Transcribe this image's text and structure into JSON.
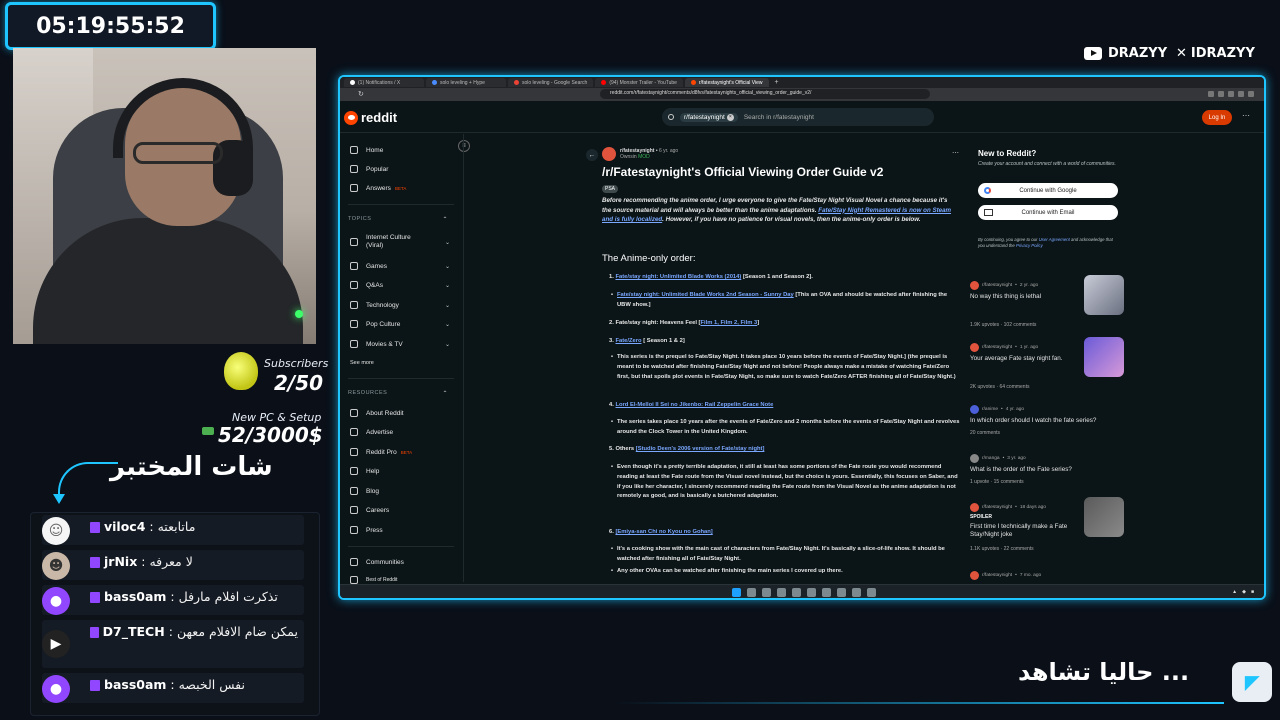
{
  "overlay": {
    "timer": "05:19:55:52",
    "subs_label": "Subscribers",
    "subs_count": "2/50",
    "pc_label": "New PC & Setup",
    "pc_count": "52/3000$",
    "chat_title": "شات المختبر",
    "youtube_handle": "DRAZYY",
    "x_handle": "IDRAZYY",
    "now_watching": "حاليا تشاهد ...",
    "chat": [
      {
        "user": "viloc4",
        "message": "ماتابعته"
      },
      {
        "user": "jrNix",
        "message": "لا معرفه"
      },
      {
        "user": "bass0am",
        "message": "تذكرت افلام مارفل"
      },
      {
        "user": "D7_TECH",
        "message": "يمكن ضام الافلام معهن"
      },
      {
        "user": "bass0am",
        "message": "نفس الخبصه"
      }
    ],
    "colors": {
      "accent": "#1ec5ff",
      "twitch": "#9146ff"
    }
  },
  "browser": {
    "tabs": [
      {
        "label": "(1) Notifications / X"
      },
      {
        "label": "solo leveling + Hype"
      },
      {
        "label": "solo leveling - Google Search"
      },
      {
        "label": "(94) Monster Trailer - YouTube"
      },
      {
        "label": "r/fatestaynight's Official View"
      }
    ],
    "url": "reddit.com/r/fatestaynight/comments/d8fvs/fatestaynights_official_viewing_order_guide_v2/"
  },
  "reddit": {
    "logo_text": "reddit",
    "search_chip": "r/fatestaynight",
    "search_placeholder": "Search in r/fatestaynight",
    "login_label": "Log In",
    "sidebar": {
      "main": [
        {
          "label": "Home"
        },
        {
          "label": "Popular"
        },
        {
          "label": "Answers",
          "badge": "BETA"
        }
      ],
      "topics_header": "TOPICS",
      "topics": [
        {
          "label": "Internet Culture (Viral)"
        },
        {
          "label": "Games"
        },
        {
          "label": "Q&As"
        },
        {
          "label": "Technology"
        },
        {
          "label": "Pop Culture"
        },
        {
          "label": "Movies & TV"
        }
      ],
      "see_more": "See more",
      "resources_header": "RESOURCES",
      "resources": [
        {
          "label": "About Reddit"
        },
        {
          "label": "Advertise"
        },
        {
          "label": "Reddit Pro",
          "badge": "BETA"
        },
        {
          "label": "Help"
        },
        {
          "label": "Blog"
        },
        {
          "label": "Careers"
        },
        {
          "label": "Press"
        }
      ],
      "communities": "Communities",
      "best_of": "Best of Reddit"
    },
    "post": {
      "subreddit": "r/fatestaynight",
      "age": "6 yr. ago",
      "author": "Ownsin",
      "author_flair": "MOD",
      "title": "/r/Fatestaynight's Official Viewing Order Guide v2",
      "flair": "PSA",
      "intro": "Before recommending the anime order, I urge everyone to give the Fate/Stay Night Visual Novel a chance because it's the source material and will always be better than the anime adaptations.",
      "intro_link": "Fate/Stay Night Remastered is now on Steam and is fully localized",
      "intro_tail": ". However, if you have no patience for visual novels, then the anime-only order is below.",
      "section_heading": "The Anime-only order:",
      "item1_num": "1.",
      "item1_link": "Fate/stay night: Unlimited Blade Works (2014)",
      "item1_tail": "[Season 1 and Season 2].",
      "item1_sub_link": "Fate/stay night: Unlimited Blade Works 2nd Season - Sunny Day",
      "item1_sub_tail": "[This an OVA and should be watched after finishing the UBW show.]",
      "item2_text": "2. Fate/stay night: Heavens Feel [",
      "item2_link": "Film 1, Film 2, Film 3",
      "item2_tail": "]",
      "item3_num": "3.",
      "item3_link": "Fate/Zero",
      "item3_tail": "[ Season 1 & 2]",
      "item3_sub": "This series is the prequel to Fate/Stay Night. It takes place 10 years before the events of Fate/Stay Night.] (the prequel is meant to be watched after finishing Fate/Stay Night and not before! People always make a mistake of watching Fate/Zero first, but that spoils plot events in Fate/Stay Night, so make sure to watch Fate/Zero AFTER finishing all of Fate/Stay Night.)",
      "item4_num": "4.",
      "item4_link": "Lord El-Melloi II Sei no Jikenbo: Rail Zeppelin Grace Note",
      "item4_sub": "The series takes place 10 years after the events of Fate/Zero and 2 months before the events of Fate/Stay Night and revolves around the Clock Tower in the United Kingdom.",
      "item5_num": "5. Others",
      "item5_link": "[Studio Deen's 2006 version of Fate/stay night]",
      "item5_sub": "Even though it's a pretty terrible adaptation, it still at least has some portions of the Fate route you would recommend reading at least the Fate route from the Visual novel instead, but the choice is yours. Essentially, this focuses on Saber, and if you like her character, I sincerely recommend reading the Fate route from the Visual Novel as the anime adaptation is not remotely as good, and is basically a butchered adaptation.",
      "item5_sub_lead": "watch it comes before UBW in the watching order. I personally wouldn't recommend it and would",
      "item6_num": "6.",
      "item6_link": "[Emiya-san Chi no Kyou no Gohan]",
      "item6_sub": "It's a cooking show with the main cast of characters from Fate/Stay Night. It's basically a slice-of-life show. It should be watched after finishing all of Fate/Stay Night.",
      "item6_sub2": "Any other OVAs can be watched after finishing the main series I covered up there."
    },
    "right": {
      "new_title": "New to Reddit?",
      "new_desc": "Create your account and connect with a world of communities.",
      "google_btn": "Continue with Google",
      "email_btn": "Continue with Email",
      "terms": "By continuing, you agree to our",
      "terms_link1": "User Agreement",
      "terms_mid": "and acknowledge that you understand the",
      "terms_link2": "Privacy Policy",
      "feed": [
        {
          "sub": "r/fatestaynight",
          "age": "2 yr. ago",
          "title": "No way this thing is lethal",
          "stats": "1.9K upvotes · 102 comments"
        },
        {
          "sub": "r/fatestaynight",
          "age": "1 yr. ago",
          "title": "Your average Fate stay night fan.",
          "stats": "2K upvotes · 64 comments"
        },
        {
          "sub": "r/anime",
          "age": "4 yr. ago",
          "title": "In which order should I watch the fate series?",
          "stats": "20 comments"
        },
        {
          "sub": "r/manga",
          "age": "3 yr. ago",
          "title": "What is the order of the Fate series?",
          "stats": "1 upvote · 15 comments"
        },
        {
          "sub": "r/fatestaynight",
          "age": "18 days ago",
          "tag": "SPOILER",
          "title": "First time I technically make a Fate Stay/Night joke",
          "stats": "1.1K upvotes · 22 comments"
        },
        {
          "sub": "r/fatestaynight",
          "age": "7 mo. ago",
          "title": "",
          "stats": ""
        }
      ]
    }
  }
}
